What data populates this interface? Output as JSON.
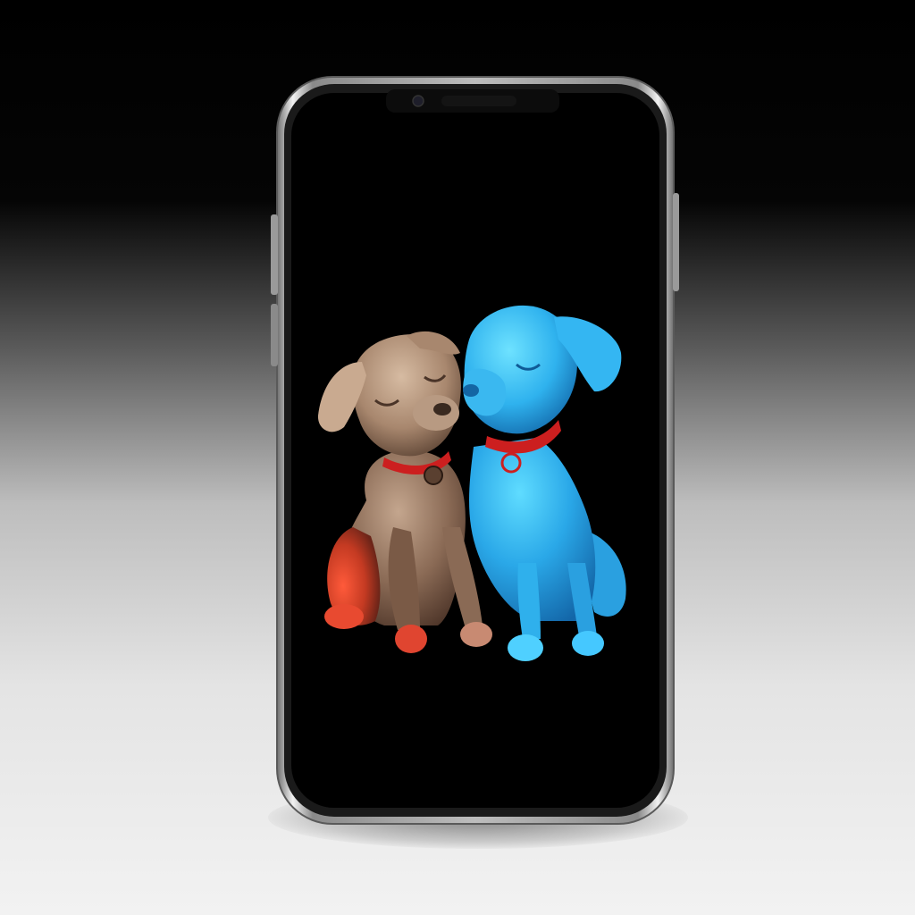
{
  "scene": {
    "background_top": "#000000",
    "background_bottom": "#f2f2f2"
  },
  "phone": {
    "frame_color": "#c8c8c8",
    "screen_color": "#000000",
    "notch_icons": [
      "camera-icon",
      "speaker-icon"
    ]
  },
  "artwork": {
    "subjects": [
      "brown-dog",
      "blue-dog"
    ],
    "colors": {
      "brown_dog": "#8a6a55",
      "brown_dog_light": "#c4a68e",
      "brown_dog_red": "#d0331f",
      "blue_dog": "#2aa8e8",
      "blue_dog_light": "#4fd0ff",
      "collar": "#cc1f1f"
    }
  }
}
